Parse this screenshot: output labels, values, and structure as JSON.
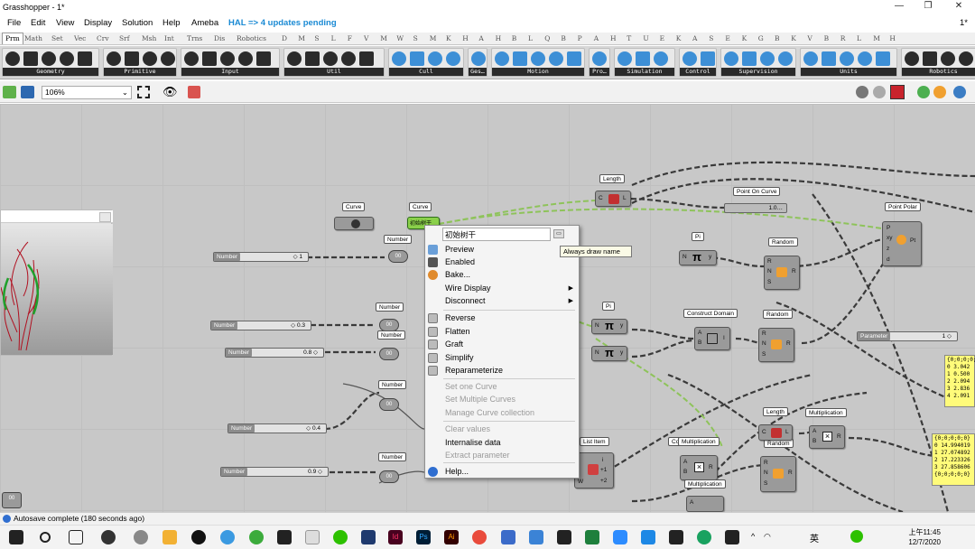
{
  "window": {
    "title": "Grasshopper - 1*",
    "doc_marker": "1*",
    "minimize": "—",
    "maximize": "❐",
    "close": "✕"
  },
  "menu": [
    "File",
    "Edit",
    "View",
    "Display",
    "Solution",
    "Help",
    "Ameba"
  ],
  "hal_notice": "HAL => 4 updates pending",
  "tabs": [
    "Prm",
    "Math",
    "Set",
    "Vec",
    "Crv",
    "Srf",
    "Msh",
    "Int",
    "Trns",
    "Dis",
    "Robotics",
    "D",
    "M",
    "S",
    "L",
    "F",
    "V",
    "M",
    "W",
    "S",
    "M",
    "K",
    "H",
    "A",
    "H",
    "B",
    "L",
    "Q",
    "B",
    "P",
    "A",
    "H",
    "T",
    "U",
    "E",
    "K",
    "A",
    "S",
    "E",
    "K",
    "G",
    "B",
    "K",
    "V",
    "B",
    "R",
    "L",
    "M",
    "H"
  ],
  "ribbon_groups": [
    "Geometry",
    "Primitive",
    "Input",
    "Util",
    "Cull",
    "Ges…",
    "Motion",
    "Pro…",
    "Simulation",
    "Control",
    "Supervision",
    "Units",
    "Robotics"
  ],
  "toolbar": {
    "zoom": "106%"
  },
  "canvas": {
    "labels": {
      "curve1": "Curve",
      "curve2": "Curve",
      "number1": "Number",
      "number2": "Number",
      "number3": "Number",
      "number4": "Number",
      "number5": "Number",
      "length1": "Length",
      "length2": "Length",
      "point_on_curve": "Point On Curve",
      "point_polar": "Point Polar",
      "pi1": "Pi",
      "pi2": "Pi",
      "random1": "Random",
      "random2": "Random",
      "random3": "Random",
      "construct_domain": "Construct Domain",
      "multiplication1": "Multiplication",
      "multiplication2": "Multiplication",
      "multiplication3": "Multiplication",
      "list_item": "List Item",
      "co": "Co"
    },
    "sliders": [
      {
        "name": "Number",
        "value": "◇ 1"
      },
      {
        "name": "Number",
        "value": "◇ 0.3"
      },
      {
        "name": "Number",
        "value": "0.8 ◇"
      },
      {
        "name": "Number",
        "value": "◇ 0.4"
      },
      {
        "name": "Number",
        "value": "0.9 ◇"
      },
      {
        "name": "Parameter",
        "value": "1 ◇"
      }
    ],
    "point_on_curve_value": "1.0…",
    "panel1": [
      "{0;0;0;0;0}",
      "0  3.042",
      "1  0.500",
      "2  2.094",
      "3  2.836",
      "4  2.091"
    ],
    "panel2": [
      "{0;0;0;0;0}",
      "0  14.994019",
      "1  27.074892",
      "2  17.223326",
      "3  27.858606",
      "{0;0;0;0;0}"
    ],
    "selected_component_name": "初始树干"
  },
  "context_menu": {
    "name_field": "初始树干",
    "tooltip": "Always draw name",
    "items": [
      {
        "label": "Preview",
        "enabled": true
      },
      {
        "label": "Enabled",
        "enabled": true
      },
      {
        "label": "Bake...",
        "enabled": true
      },
      {
        "label": "Wire Display",
        "enabled": true,
        "submenu": true
      },
      {
        "label": "Disconnect",
        "enabled": true,
        "submenu": true
      },
      {
        "label": "Reverse",
        "enabled": true
      },
      {
        "label": "Flatten",
        "enabled": true
      },
      {
        "label": "Graft",
        "enabled": true
      },
      {
        "label": "Simplify",
        "enabled": true
      },
      {
        "label": "Reparameterize",
        "enabled": true
      },
      {
        "label": "Set one Curve",
        "enabled": false
      },
      {
        "label": "Set Multiple Curves",
        "enabled": false
      },
      {
        "label": "Manage Curve collection",
        "enabled": false
      },
      {
        "label": "Clear values",
        "enabled": false
      },
      {
        "label": "Internalise data",
        "enabled": true
      },
      {
        "label": "Extract parameter",
        "enabled": false
      },
      {
        "label": "Help...",
        "enabled": true
      }
    ]
  },
  "status": {
    "text": "Autosave complete (180 seconds ago)"
  },
  "taskbar": {
    "time": "上午11:45",
    "date": "12/7/2020",
    "ime": "英",
    "apps": [
      "Id",
      "Ps",
      "Ai"
    ]
  }
}
